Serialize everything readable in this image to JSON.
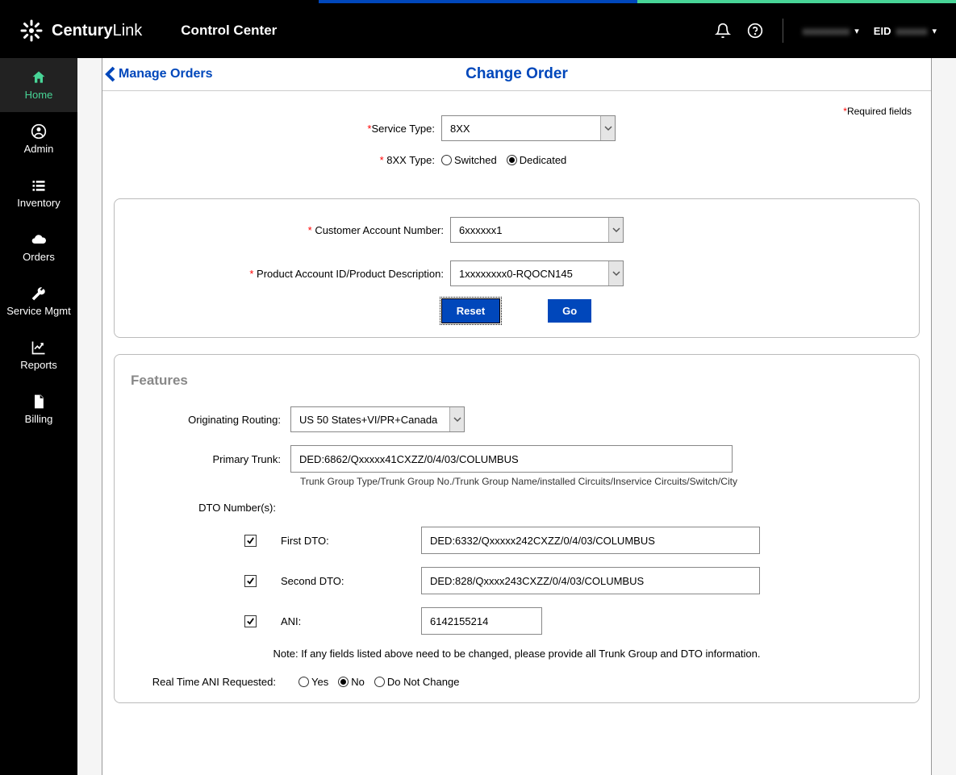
{
  "header": {
    "brand_prefix": "Century",
    "brand_suffix": "Link",
    "app_title": "Control Center",
    "eid_label": "EID",
    "username_masked": "xxxxxxxxx",
    "eid_masked": "xxxxxx"
  },
  "sidebar": {
    "items": [
      {
        "label": "Home",
        "icon": "home-icon"
      },
      {
        "label": "Admin",
        "icon": "user-circle-icon"
      },
      {
        "label": "Inventory",
        "icon": "list-icon"
      },
      {
        "label": "Orders",
        "icon": "cloud-down-icon"
      },
      {
        "label": "Service Mgmt",
        "icon": "wrench-icon"
      },
      {
        "label": "Reports",
        "icon": "chart-line-icon"
      },
      {
        "label": "Billing",
        "icon": "document-icon"
      }
    ]
  },
  "page": {
    "back_label": "Manage Orders",
    "title": "Change Order",
    "required_note": "Required fields"
  },
  "form": {
    "service_type_label": "Service Type:",
    "service_type_value": "8XX",
    "xx_type_label": "8XX Type:",
    "xx_type_options": {
      "switched": "Switched",
      "dedicated": "Dedicated"
    },
    "xx_type_selected": "dedicated",
    "cust_acct_label": "Customer Account Number:",
    "cust_acct_value": "6xxxxxx1",
    "prod_acct_label": "Product Account ID/Product Description:",
    "prod_acct_value": "1xxxxxxxx0-RQOCN145",
    "reset_btn": "Reset",
    "go_btn": "Go"
  },
  "features": {
    "section_title": "Features",
    "orig_routing_label": "Originating Routing:",
    "orig_routing_value": "US 50 States+VI/PR+Canada",
    "primary_trunk_label": "Primary Trunk:",
    "primary_trunk_value": "DED:6862/Qxxxxx41CXZZ/0/4/03/COLUMBUS",
    "primary_trunk_hint": "Trunk Group Type/Trunk Group No./Trunk Group Name/installed Circuits/Inservice Circuits/Switch/City",
    "dto_label": "DTO Number(s):",
    "first_dto_label": "First DTO:",
    "first_dto_value": "DED:6332/Qxxxxx242CXZZ/0/4/03/COLUMBUS",
    "second_dto_label": "Second DTO:",
    "second_dto_value": "DED:828/Qxxxx243CXZZ/0/4/03/COLUMBUS",
    "ani_label": "ANI:",
    "ani_value": "6142155214",
    "note": "Note: If any fields listed above need to be changed, please provide all Trunk Group and DTO information.",
    "rta_label": "Real Time ANI Requested:",
    "rta_options": {
      "yes": "Yes",
      "no": "No",
      "dnc": "Do Not Change"
    },
    "rta_selected": "no"
  }
}
